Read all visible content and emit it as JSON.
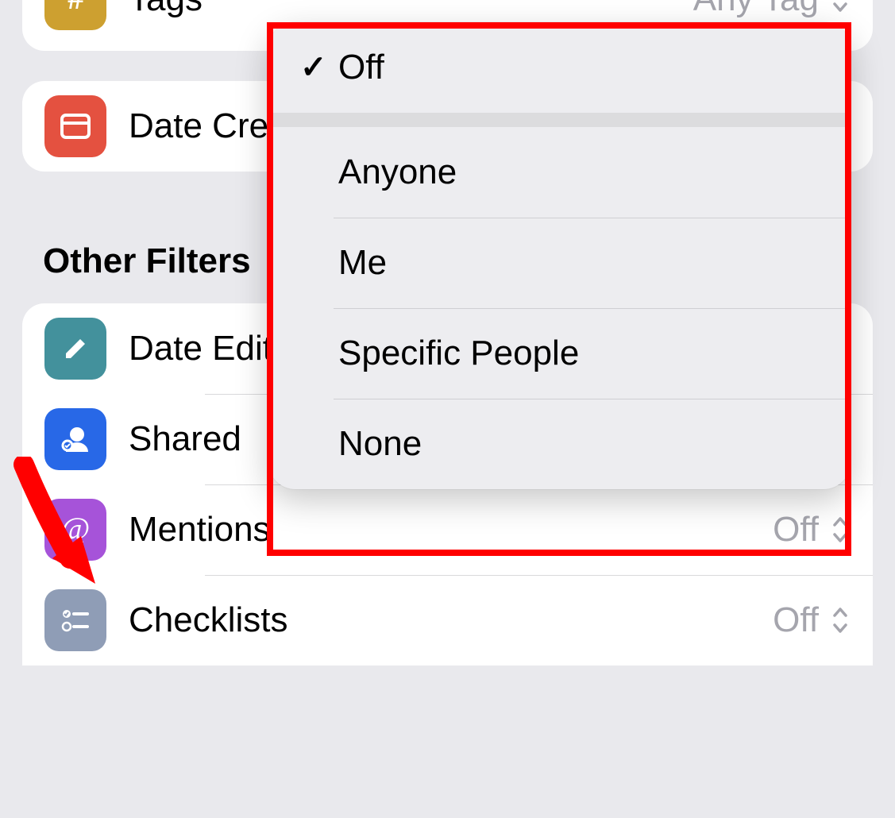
{
  "filters_top": {
    "tags": {
      "label": "Tags",
      "value": "Any Tag"
    },
    "date_created": {
      "label": "Date Created"
    }
  },
  "section_header": "Other Filters",
  "other_filters": {
    "date_edited": {
      "label": "Date Edited"
    },
    "shared": {
      "label": "Shared"
    },
    "mentions": {
      "label": "Mentions",
      "value": "Off"
    },
    "checklists": {
      "label": "Checklists",
      "value": "Off"
    }
  },
  "popup": {
    "selected": "Off",
    "items": [
      {
        "label": "Off",
        "checked": true
      },
      {
        "label": "Anyone"
      },
      {
        "label": "Me"
      },
      {
        "label": "Specific People"
      },
      {
        "label": "None"
      }
    ]
  }
}
